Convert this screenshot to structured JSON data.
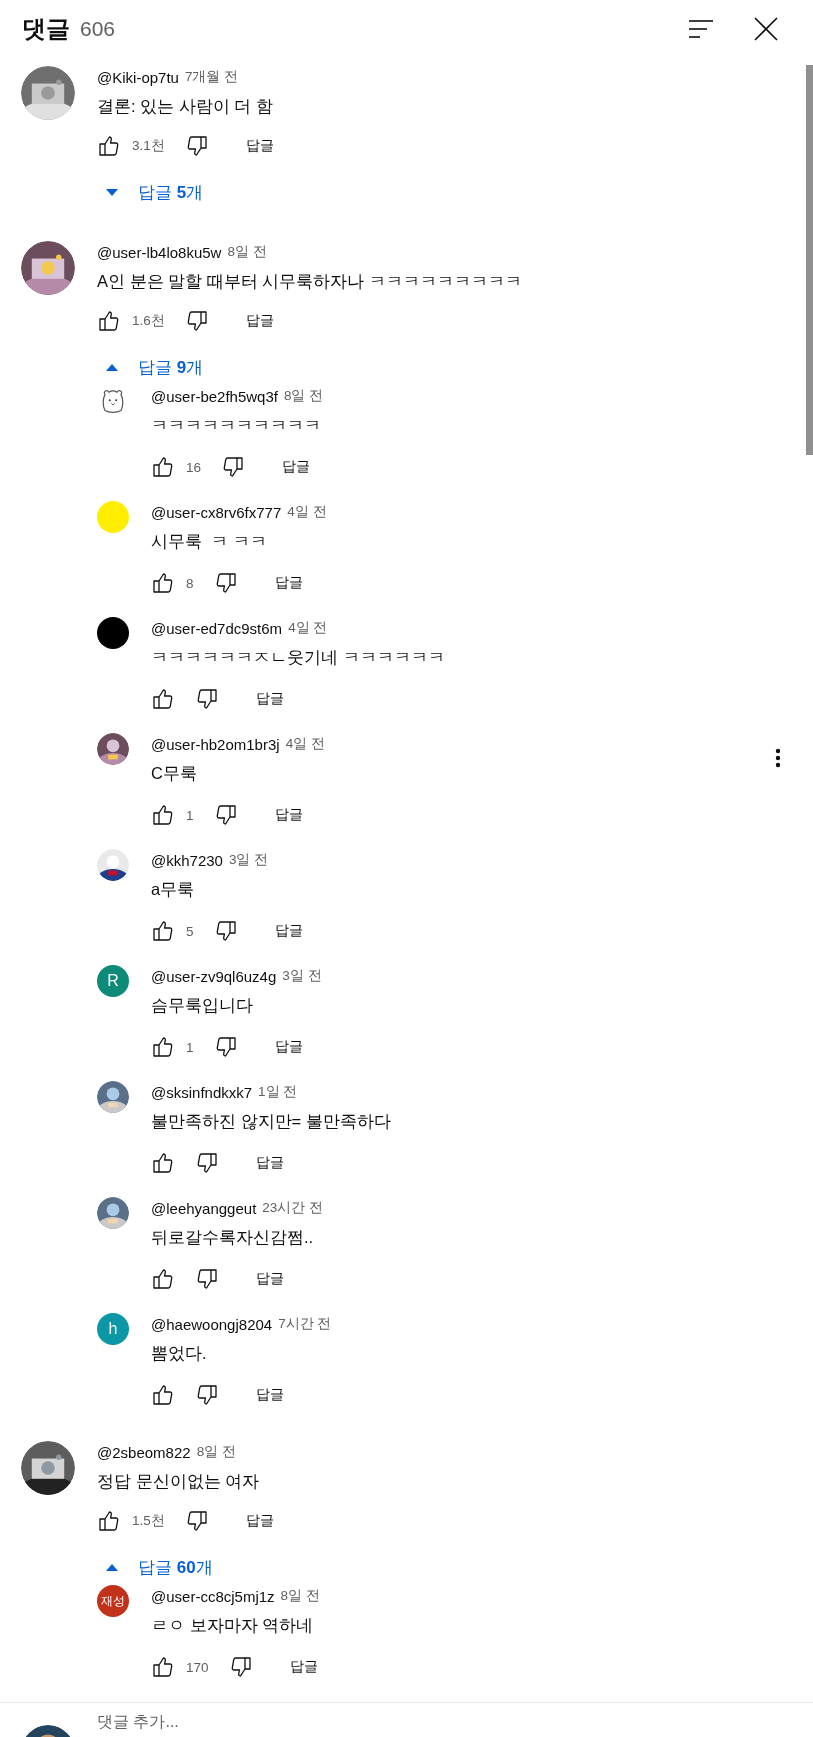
{
  "header": {
    "title": "댓글",
    "count": "606"
  },
  "comments": [
    {
      "author": "@Kiki-op7tu",
      "time": "7개월 전",
      "text": "결론: 있는 사람이 더 함",
      "likes": "3.1천",
      "reply_button": "답글",
      "replies_toggle": {
        "label": "답글 **5**개",
        "expanded": false
      }
    },
    {
      "author": "@user-lb4lo8ku5w",
      "time": "8일 전",
      "text": "A인 분은 말할 때부터 시무룩하자나 ㅋㅋㅋㅋㅋㅋㅋㅋㅋ",
      "likes": "1.6천",
      "reply_button": "답글",
      "replies_toggle": {
        "label": "답글 **9**개",
        "expanded": true
      },
      "replies": [
        {
          "avatar": {
            "kind": "icon"
          },
          "author": "@user-be2fh5wq3f",
          "time": "8일 전",
          "text": "ㅋㅋㅋㅋㅋㅋㅋㅋㅋㅋ",
          "likes": "16",
          "reply_button": "답글",
          "menu": false
        },
        {
          "avatar": {
            "kind": "solid",
            "color": "#ffee00"
          },
          "author": "@user-cx8rv6fx777",
          "time": "4일 전",
          "text": "시무룩  ㅋ ㅋㅋ",
          "likes": "8",
          "reply_button": "답글",
          "menu": false
        },
        {
          "avatar": {
            "kind": "solid",
            "color": "#000000"
          },
          "author": "@user-ed7dc9st6m",
          "time": "4일 전",
          "text": "ㅋㅋㅋㅋㅋㅋㅈㄴ웃기네 ㅋㅋㅋㅋㅋㅋ",
          "reply_button": "답글",
          "menu": false
        },
        {
          "author": "@user-hb2om1br3j",
          "time": "4일 전",
          "text": "C무룩",
          "likes": "1",
          "reply_button": "답글",
          "menu": true
        },
        {
          "author": "@kkh7230",
          "time": "3일 전",
          "text": "a무룩",
          "likes": "5",
          "reply_button": "답글",
          "menu": false
        },
        {
          "avatar": {
            "kind": "letter",
            "letter": "R",
            "color": "#0e8a79"
          },
          "author": "@user-zv9ql6uz4g",
          "time": "3일 전",
          "text": "슴무룩입니다",
          "likes": "1",
          "reply_button": "답글",
          "menu": false
        },
        {
          "author": "@sksinfndkxk7",
          "time": "1일 전",
          "text": "불만족하진 않지만= 불만족하다",
          "reply_button": "답글",
          "menu": false
        },
        {
          "author": "@leehyanggeut",
          "time": "23시간 전",
          "text": "뒤로갈수록자신감쩜..",
          "reply_button": "답글",
          "menu": false
        },
        {
          "avatar": {
            "kind": "letter",
            "letter": "h",
            "color": "#0b97a5"
          },
          "author": "@haewoongj8204",
          "time": "7시간 전",
          "text": "뽐었다.",
          "reply_button": "답글",
          "menu": false
        }
      ]
    },
    {
      "author": "@2sbeom822",
      "time": "8일 전",
      "text": "정답 문신이없는 여자",
      "likes": "1.5천",
      "reply_button": "답글",
      "replies_toggle": {
        "label": "답글 **60**개",
        "expanded": true
      },
      "replies": [
        {
          "avatar": {
            "kind": "letter",
            "letter": "재성",
            "color": "#c2321b"
          },
          "author": "@user-cc8cj5mj1z",
          "time": "8일 전",
          "text": "ㄹㅇ 보자마자 역하네",
          "likes": "170",
          "reply_button": "답글",
          "menu": false
        }
      ]
    }
  ],
  "composer": {
    "placeholder": "댓글 추가..."
  }
}
